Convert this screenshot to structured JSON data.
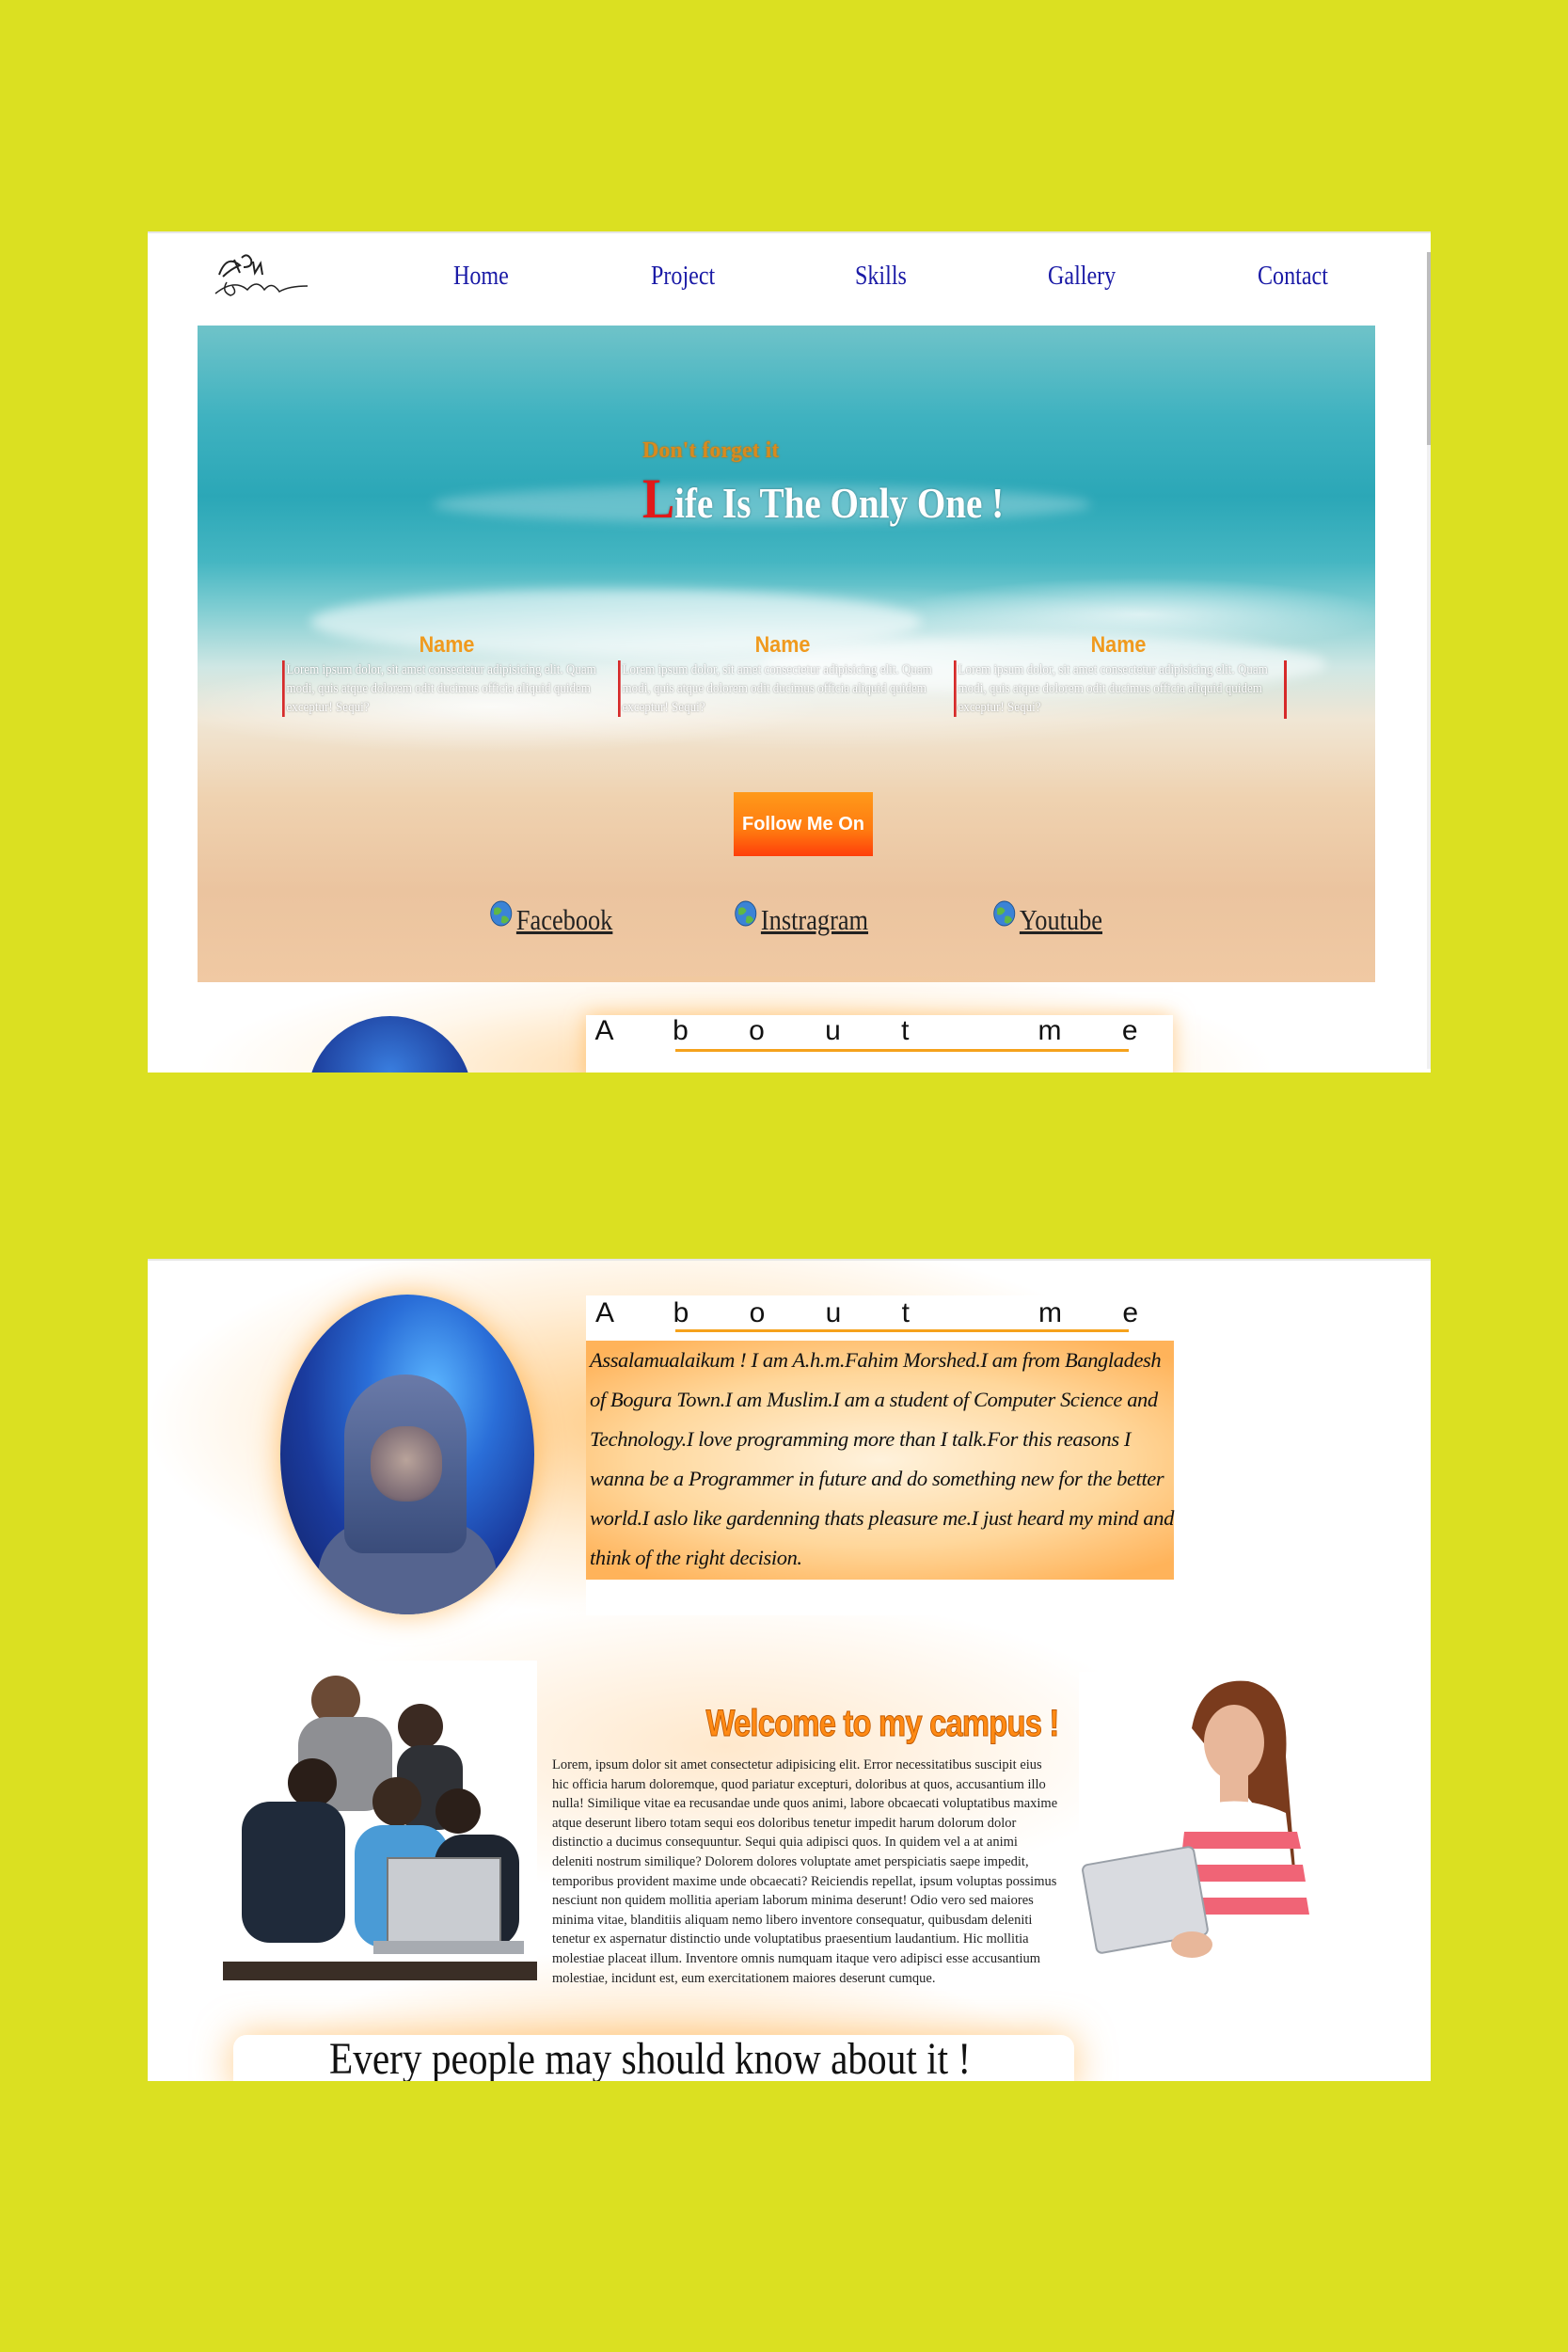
{
  "nav": {
    "links": [
      "Home",
      "Project",
      "Skills",
      "Gallery",
      "Contact"
    ]
  },
  "hero": {
    "kicker": "Don't forget it",
    "title_initial": "L",
    "title_rest": "ife Is The Only One !",
    "columns": [
      {
        "heading": "Name",
        "text": "Lorem ipsum dolor, sit amet consectetur adipisicing elit. Quam modi, quis atque dolorem odit ducimus officia aliquid quidem exceptur! Sequi?"
      },
      {
        "heading": "Name",
        "text": "Lorem ipsum dolor, sit amet consectetur adipisicing elit. Quam modi, quis atque dolorem odit ducimus officia aliquid quidem exceptur! Sequi?"
      },
      {
        "heading": "Name",
        "text": "Lorem ipsum dolor, sit amet consectetur adipisicing elit. Quam modi, quis atque dolorem odit ducimus officia aliquid quidem exceptur! Sequi?"
      }
    ],
    "follow_button": "Follow Me On",
    "social": [
      "Facebook",
      "Instragram",
      "Youtube"
    ]
  },
  "about": {
    "title": "A b o u t   m e",
    "text": "Assalamualaikum ! I am A.h.m.Fahim Morshed.I am from Bangladesh of Bogura Town.I am Muslim.I am a student of Computer Science and Technology.I love programming more than I talk.For this reasons I wanna be a Programmer in future and do something new for the better world.I aslo like gardenning thats pleasure me.I just heard my mind and think of the right decision."
  },
  "campus": {
    "title": "Welcome to my campus !",
    "text": "Lorem, ipsum dolor sit amet consectetur adipisicing elit. Error necessitatibus suscipit eius hic officia harum doloremque, quod pariatur excepturi, doloribus at quos, accusantium illo nulla! Similique vitae ea recusandae unde quos animi, labore obcaecati voluptatibus maxime atque deserunt libero totam sequi eos doloribus tenetur impedit harum dolorum dolor distinctio a ducimus consequuntur. Sequi quia adipisci quos. In quidem vel a at animi deleniti nostrum similique? Dolorem dolores voluptate amet perspiciatis saepe impedit, temporibus provident maxime unde obcaecati? Reiciendis repellat, ipsum voluptas possimus nesciunt non quidem mollitia aperiam laborum minima deserunt! Odio vero sed maiores minima vitae, blanditiis aliquam nemo libero inventore consequatur, quibusdam deleniti tenetur ex aspernatur distinctio unde voluptatibus praesentium laudantium. Hic mollitia molestiae placeat illum. Inventore omnis numquam itaque vero adipisci esse accusantium molestiae, incidunt est, eum exercitationem maiores deserunt cumque."
  },
  "bottom": {
    "heading": "Every people may should know about it !"
  },
  "colors": {
    "page_bg": "#dbe021",
    "nav_link": "#1a1aa6",
    "accent_orange": "#f09a1e",
    "accent_red": "#e11919",
    "button_orange": "#ff7a10"
  },
  "icons": [
    "logo-signature",
    "globe-icon"
  ]
}
